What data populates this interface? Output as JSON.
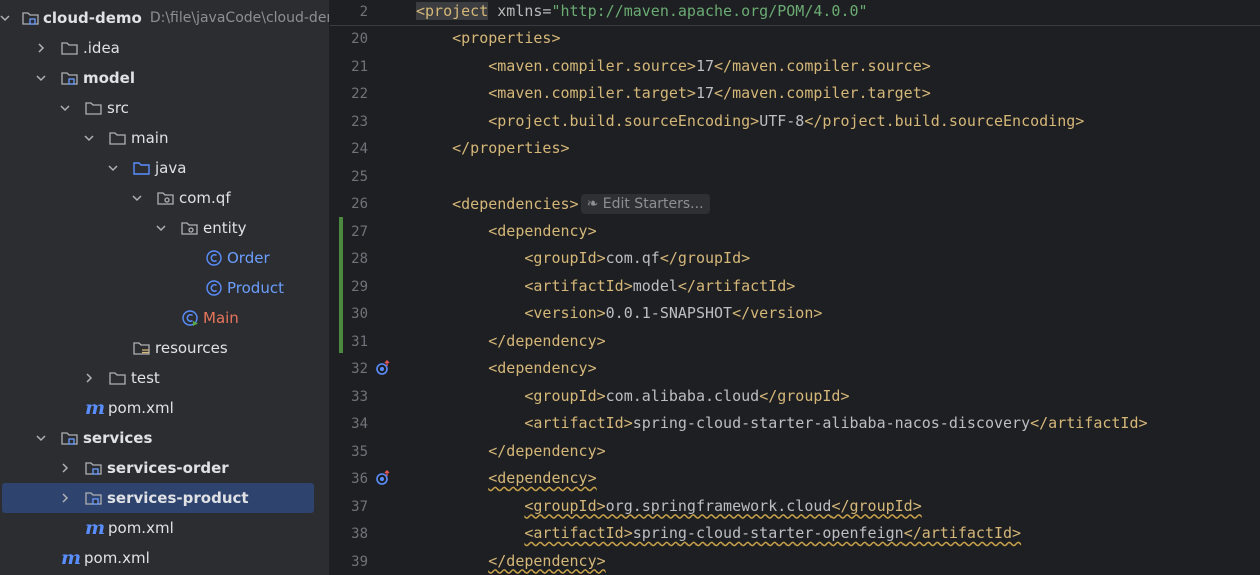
{
  "tree": {
    "rows": [
      {
        "label": "cloud-demo",
        "extra": "D:\\file\\javaCode\\cloud-demo",
        "indent": 0,
        "chevron": "down",
        "icon": "module-folder",
        "style": "bold"
      },
      {
        "label": ".idea",
        "indent": 1,
        "chevron": "right",
        "icon": "folder",
        "style": ""
      },
      {
        "label": "model",
        "indent": 1,
        "chevron": "down",
        "icon": "module-folder",
        "style": "bold"
      },
      {
        "label": "src",
        "indent": 2,
        "chevron": "down",
        "icon": "folder",
        "style": ""
      },
      {
        "label": "main",
        "indent": 3,
        "chevron": "down",
        "icon": "folder",
        "style": ""
      },
      {
        "label": "java",
        "indent": 4,
        "chevron": "down",
        "icon": "source-folder",
        "style": ""
      },
      {
        "label": "com.qf",
        "indent": 5,
        "chevron": "down",
        "icon": "package",
        "style": ""
      },
      {
        "label": "entity",
        "indent": 6,
        "chevron": "down",
        "icon": "package",
        "style": ""
      },
      {
        "label": "Order",
        "indent": 7,
        "chevron": "none",
        "icon": "class",
        "style": "cls"
      },
      {
        "label": "Product",
        "indent": 7,
        "chevron": "none",
        "icon": "class",
        "style": "cls"
      },
      {
        "label": "Main",
        "indent": 6,
        "chevron": "none",
        "icon": "main-class",
        "style": "mainc"
      },
      {
        "label": "resources",
        "indent": 4,
        "chevron": "none",
        "icon": "resources-folder",
        "style": ""
      },
      {
        "label": "test",
        "indent": 3,
        "chevron": "right",
        "icon": "folder",
        "style": ""
      },
      {
        "label": "pom.xml",
        "indent": 2,
        "chevron": "none",
        "icon": "maven",
        "style": "pom"
      },
      {
        "label": "services",
        "indent": 1,
        "chevron": "down",
        "icon": "module-folder",
        "style": "bold"
      },
      {
        "label": "services-order",
        "indent": 2,
        "chevron": "right",
        "icon": "module-folder",
        "style": "bold"
      },
      {
        "label": "services-product",
        "indent": 2,
        "chevron": "right",
        "icon": "module-folder",
        "style": "bold",
        "selected": true
      },
      {
        "label": "pom.xml",
        "indent": 2,
        "chevron": "none",
        "icon": "maven",
        "style": "pom"
      },
      {
        "label": "pom.xml",
        "indent": 1,
        "chevron": "none",
        "icon": "maven",
        "style": "pom"
      }
    ]
  },
  "editor": {
    "sticky": {
      "line": "2",
      "tokens": [
        [
          "tag-hl",
          "<project"
        ],
        [
          "attr",
          " xmlns="
        ],
        [
          "str",
          "\"http://maven.apache.org/POM/4.0.0\""
        ]
      ]
    },
    "inlay_label": "Edit Starters...",
    "lines": [
      {
        "n": "20",
        "tokens": [
          [
            "txt",
            "    "
          ],
          [
            "tag",
            "<properties>"
          ]
        ]
      },
      {
        "n": "21",
        "tokens": [
          [
            "txt",
            "        "
          ],
          [
            "tag",
            "<maven.compiler.source>"
          ],
          [
            "txt",
            "17"
          ],
          [
            "tag",
            "</maven.compiler.source>"
          ]
        ]
      },
      {
        "n": "22",
        "tokens": [
          [
            "txt",
            "        "
          ],
          [
            "tag",
            "<maven.compiler.target>"
          ],
          [
            "txt",
            "17"
          ],
          [
            "tag",
            "</maven.compiler.target>"
          ]
        ]
      },
      {
        "n": "23",
        "tokens": [
          [
            "txt",
            "        "
          ],
          [
            "tag",
            "<project.build.sourceEncoding>"
          ],
          [
            "txt",
            "UTF-8"
          ],
          [
            "tag",
            "</project.build.sourceEncoding>"
          ]
        ]
      },
      {
        "n": "24",
        "tokens": [
          [
            "txt",
            "    "
          ],
          [
            "tag",
            "</properties>"
          ]
        ]
      },
      {
        "n": "25",
        "tokens": []
      },
      {
        "n": "26",
        "tokens": [
          [
            "txt",
            "    "
          ],
          [
            "tag",
            "<dependencies>"
          ],
          [
            "inlay",
            ""
          ]
        ]
      },
      {
        "n": "27",
        "tokens": [
          [
            "txt",
            "        "
          ],
          [
            "tag",
            "<dependency>"
          ]
        ]
      },
      {
        "n": "28",
        "tokens": [
          [
            "txt",
            "            "
          ],
          [
            "tag",
            "<groupId>"
          ],
          [
            "txt",
            "com.qf"
          ],
          [
            "tag",
            "</groupId>"
          ]
        ]
      },
      {
        "n": "29",
        "tokens": [
          [
            "txt",
            "            "
          ],
          [
            "tag",
            "<artifactId>"
          ],
          [
            "txt",
            "model"
          ],
          [
            "tag",
            "</artifactId>"
          ]
        ]
      },
      {
        "n": "30",
        "tokens": [
          [
            "txt",
            "            "
          ],
          [
            "tag",
            "<version>"
          ],
          [
            "txt",
            "0.0.1-SNAPSHOT"
          ],
          [
            "tag",
            "</version>"
          ]
        ]
      },
      {
        "n": "31",
        "tokens": [
          [
            "txt",
            "        "
          ],
          [
            "tag",
            "</dependency>"
          ]
        ]
      },
      {
        "n": "32",
        "tokens": [
          [
            "txt",
            "        "
          ],
          [
            "tag",
            "<dependency>"
          ]
        ]
      },
      {
        "n": "33",
        "tokens": [
          [
            "txt",
            "            "
          ],
          [
            "tag",
            "<groupId>"
          ],
          [
            "txt",
            "com.alibaba.cloud"
          ],
          [
            "tag",
            "</groupId>"
          ]
        ]
      },
      {
        "n": "34",
        "tokens": [
          [
            "txt",
            "            "
          ],
          [
            "tag",
            "<artifactId>"
          ],
          [
            "txt",
            "spring-cloud-starter-alibaba-nacos-discovery"
          ],
          [
            "tag",
            "</artifactId>"
          ]
        ]
      },
      {
        "n": "35",
        "tokens": [
          [
            "txt",
            "        "
          ],
          [
            "tag",
            "</dependency>"
          ]
        ]
      },
      {
        "n": "36",
        "tokens": [
          [
            "txt",
            "        "
          ],
          [
            "tag-w",
            "<dependency>"
          ]
        ]
      },
      {
        "n": "37",
        "tokens": [
          [
            "txt",
            "            "
          ],
          [
            "tag-w",
            "<groupId>"
          ],
          [
            "txt-w",
            "org.springframework.cloud"
          ],
          [
            "tag-w",
            "</groupId>"
          ]
        ]
      },
      {
        "n": "38",
        "tokens": [
          [
            "txt",
            "            "
          ],
          [
            "tag-w",
            "<artifactId>"
          ],
          [
            "txt-w",
            "spring-cloud-starter-openfeign"
          ],
          [
            "tag-w",
            "</artifactId>"
          ]
        ]
      },
      {
        "n": "39",
        "tokens": [
          [
            "txt",
            "        "
          ],
          [
            "tag-w",
            "</dependency>"
          ]
        ]
      }
    ]
  },
  "colors": {
    "tag": "#d5b778",
    "string": "#6aab73",
    "text": "#bcbec4",
    "selection": "#2e436e",
    "changebar": "#4b8a3e"
  }
}
